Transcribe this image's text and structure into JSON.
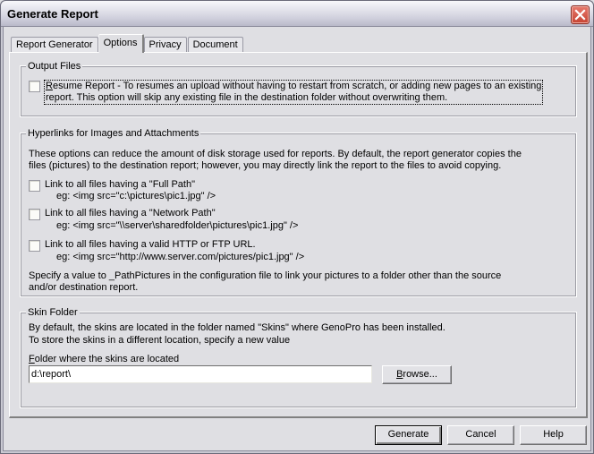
{
  "window": {
    "title": "Generate Report",
    "close_icon": "close-x-icon"
  },
  "tabs": [
    {
      "label": "Report Generator",
      "active": false
    },
    {
      "label": "Options",
      "active": true
    },
    {
      "label": "Privacy",
      "active": false
    },
    {
      "label": "Document",
      "active": false
    }
  ],
  "output_files": {
    "legend": "Output Files",
    "resume_report": {
      "checked": false,
      "mnemonic": "R",
      "label_rest_line1": "esume Report - To resumes an upload without having to restart from scratch, or adding new pages to an existing",
      "label_line2": "report. This option will skip any existing file in the destination folder without overwriting them."
    }
  },
  "hyperlinks": {
    "legend": "Hyperlinks for Images and Attachments",
    "description_line1": "These options can reduce the amount of disk storage used for reports.  By default, the report generator copies the",
    "description_line2": "files (pictures) to the destination report; however, you may directly link the report to the files to avoid copying.",
    "options": [
      {
        "label": "Link to all files having a \"Full Path\"",
        "example": "eg: <img src=\"c:\\pictures\\pic1.jpg\" />",
        "checked": false
      },
      {
        "label": "Link to all files having a \"Network Path\"",
        "example": "eg: <img src=\"\\\\server\\sharedfolder\\pictures\\pic1.jpg\" />",
        "checked": false
      },
      {
        "label": "Link to all files having a valid HTTP or FTP URL.",
        "example": "eg: <img src=\"http://www.server.com/pictures/pic1.jpg\" />",
        "checked": false
      }
    ],
    "note_line1": "Specify a value to _PathPictures in the configuration file to link your pictures to a folder other than the source",
    "note_line2": "and/or destination report."
  },
  "skin_folder": {
    "legend": "Skin Folder",
    "description_line1": "By default, the skins are located in the folder named \"Skins\" where GenoPro has been installed.",
    "description_line2": "To store the skins in a different location, specify a new value",
    "field_mnemonic": "F",
    "field_label_rest": "older where the skins are located",
    "field_value": "d:\\report\\",
    "browse_mnemonic": "B",
    "browse_rest": "rowse..."
  },
  "buttons": {
    "generate": "Generate",
    "cancel": "Cancel",
    "help": "Help"
  }
}
